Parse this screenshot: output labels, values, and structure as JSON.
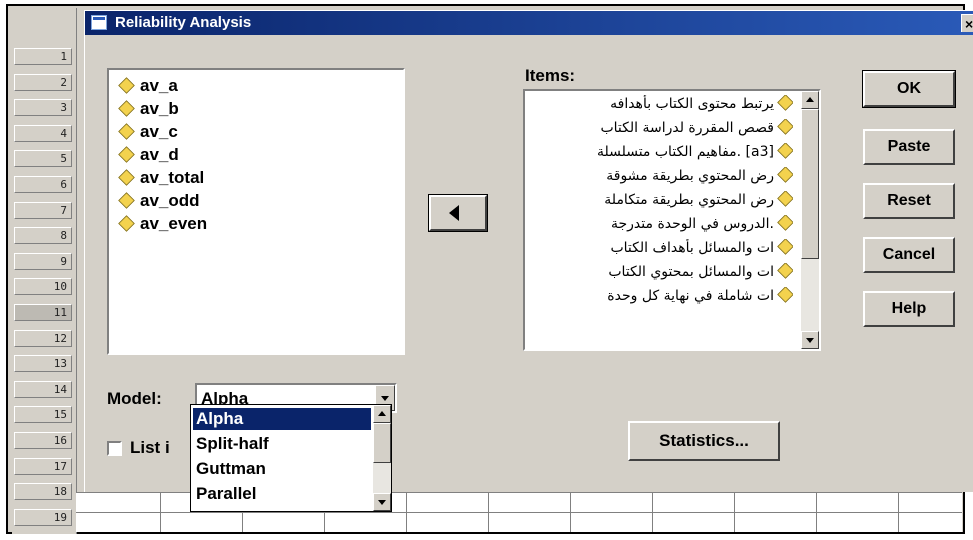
{
  "dialog": {
    "title": "Reliability Analysis",
    "close_glyph": "×"
  },
  "row_headers": [
    "1",
    "2",
    "3",
    "4",
    "5",
    "6",
    "7",
    "8",
    "9",
    "10",
    "11",
    "12",
    "13",
    "14",
    "15",
    "16",
    "17",
    "18",
    "19"
  ],
  "selected_row": "11",
  "source_variables": [
    {
      "label": "av_a",
      "icon": "scale-variable-icon"
    },
    {
      "label": "av_b",
      "icon": "scale-variable-icon"
    },
    {
      "label": "av_c",
      "icon": "scale-variable-icon"
    },
    {
      "label": "av_d",
      "icon": "scale-variable-icon"
    },
    {
      "label": "av_total",
      "icon": "scale-variable-icon"
    },
    {
      "label": "av_odd",
      "icon": "scale-variable-icon"
    },
    {
      "label": "av_even",
      "icon": "scale-variable-icon"
    }
  ],
  "items": {
    "label": "Items:",
    "rows": [
      "يرتبط محتوى الكتاب بأهدافه",
      "قصص المقررة لدراسة الكتاب",
      "[a3] .مفاهيم الكتاب متسلسلة",
      "رض المحتوي بطريقة مشوقة",
      "رض المحتوي بطريقة متكاملة",
      ".الدروس في الوحدة متدرجة",
      "ات والمسائل بأهداف الكتاب",
      "ات والمسائل بمحتوي الكتاب",
      "ات شاملة في نهاية كل وحدة"
    ]
  },
  "buttons": {
    "ok": "OK",
    "paste": "Paste",
    "reset": "Reset",
    "cancel": "Cancel",
    "help": "Help",
    "statistics": "Statistics..."
  },
  "model": {
    "label": "Model:",
    "selected": "Alpha",
    "options": [
      "Alpha",
      "Split-half",
      "Guttman",
      "Parallel"
    ]
  },
  "list_items_checkbox": {
    "label": "List i",
    "checked": false
  },
  "colors": {
    "title_bar": "#0a246a",
    "dialog_face": "#d4d0c8",
    "selection": "#0a246a"
  }
}
